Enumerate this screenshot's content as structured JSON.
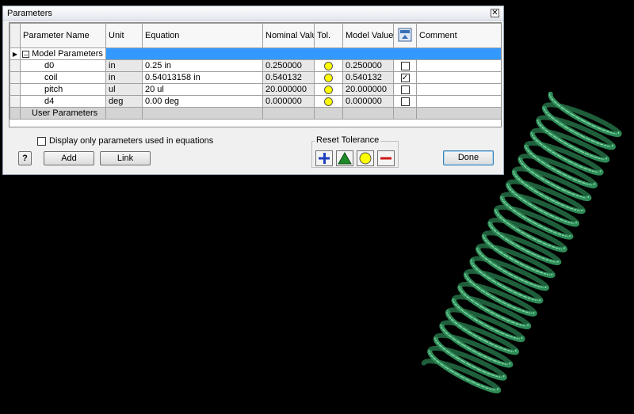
{
  "dialog": {
    "title": "Parameters",
    "close": "✕"
  },
  "table": {
    "columns": [
      "Parameter Name",
      "Unit",
      "Equation",
      "Nominal Value",
      "Tol.",
      "Model Value",
      "",
      "Comment"
    ],
    "model_group": "Model Parameters",
    "user_group": "User Parameters",
    "rows": [
      {
        "name": "d0",
        "unit": "in",
        "equation": "0.25 in",
        "nominal": "0.250000",
        "model": "0.250000",
        "checked": false
      },
      {
        "name": "coil",
        "unit": "in",
        "equation": "0.54013158 in",
        "nominal": "0.540132",
        "model": "0.540132",
        "checked": true
      },
      {
        "name": "pitch",
        "unit": "ul",
        "equation": "20 ul",
        "nominal": "20.000000",
        "model": "20.000000",
        "checked": false
      },
      {
        "name": "d4",
        "unit": "deg",
        "equation": "0.00 deg",
        "nominal": "0.000000",
        "model": "0.000000",
        "checked": false
      }
    ]
  },
  "controls": {
    "display_only": "Display only parameters used in equations",
    "add": "Add",
    "link": "Link",
    "done": "Done",
    "reset_tolerance": "Reset Tolerance",
    "help": "?",
    "expander": "–",
    "check": "✓"
  },
  "colors": {
    "selection": "#3399ff",
    "spring": "#2e8b57",
    "tol_yellow": "#ffff00"
  }
}
